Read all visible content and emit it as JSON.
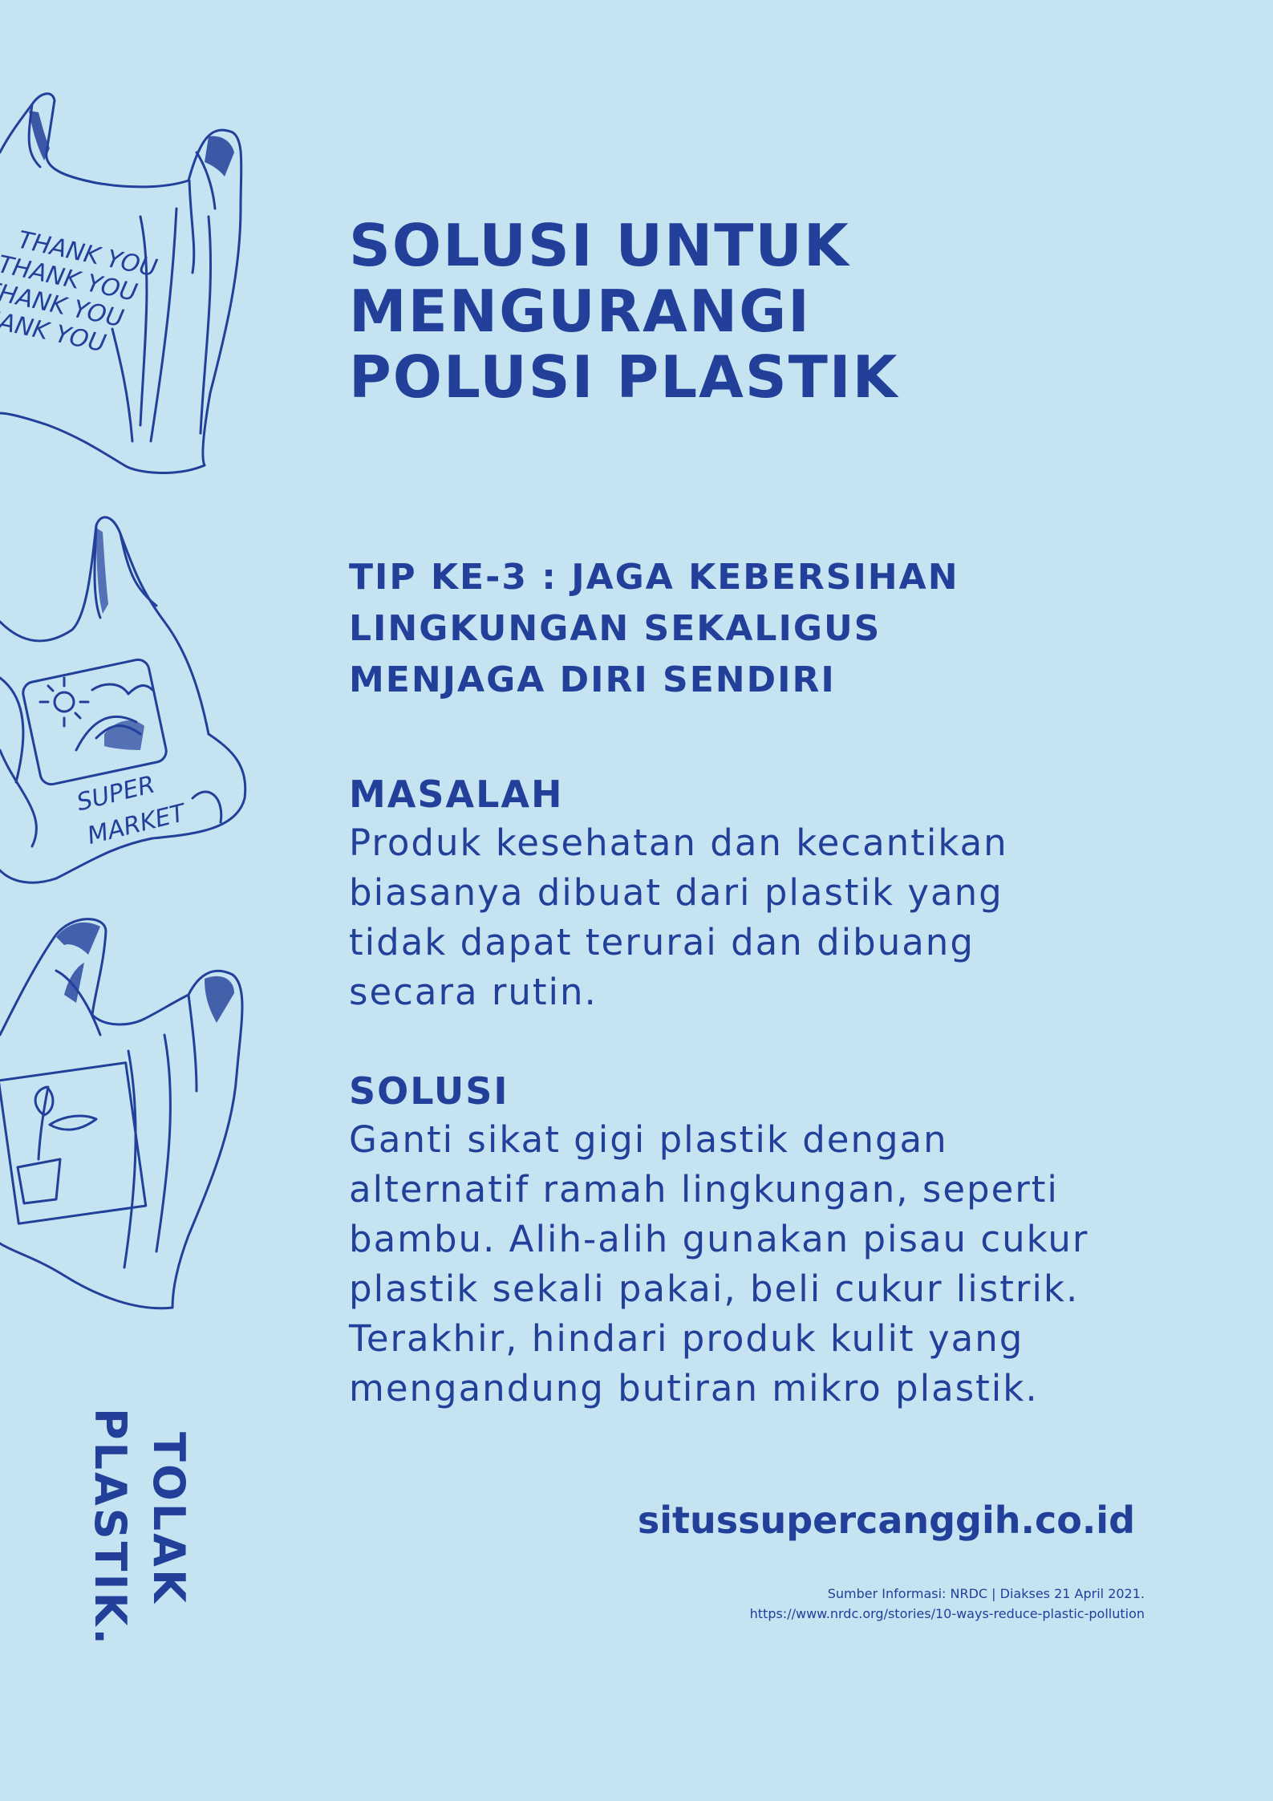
{
  "title": {
    "lines": [
      "SOLUSI UNTUK",
      "MENGURANGI",
      "POLUSI PLASTIK"
    ]
  },
  "subtitle": {
    "lines": [
      "TIP KE-3 : JAGA KEBERSIHAN",
      "LINGKUNGAN SEKALIGUS",
      "MENJAGA DIRI SENDIRI"
    ]
  },
  "masalah": {
    "heading": "MASALAH",
    "lines": [
      "Produk kesehatan dan kecantikan",
      "biasanya dibuat dari plastik yang",
      "tidak dapat terurai dan dibuang",
      "secara rutin."
    ]
  },
  "solusi": {
    "heading": "SOLUSI",
    "lines": [
      "Ganti sikat gigi plastik dengan",
      "alternatif ramah lingkungan, seperti",
      "bambu. Alih-alih gunakan pisau cukur",
      "plastik sekali pakai, beli cukur listrik.",
      "Terakhir, hindari produk kulit yang",
      "mengandung butiran mikro plastik."
    ]
  },
  "website": "situssupercanggih.co.id",
  "source": {
    "lines": [
      "Sumber Informasi: NRDC | Diakses 21 April 2021.",
      "https://www.nrdc.org/stories/10-ways-reduce-plastic-pollution"
    ]
  },
  "vertical_slogan": {
    "line1": "TOLAK",
    "line2": "PLASTIK."
  },
  "bags": {
    "bag1_text": [
      "THANK YOU",
      "THANK YOU",
      "THANK YOU",
      "THANK YOU"
    ],
    "bag2_text": [
      "SUPER",
      "MARKET"
    ]
  },
  "colors": {
    "background": "#c5e3f1",
    "ink": "#22409a"
  }
}
